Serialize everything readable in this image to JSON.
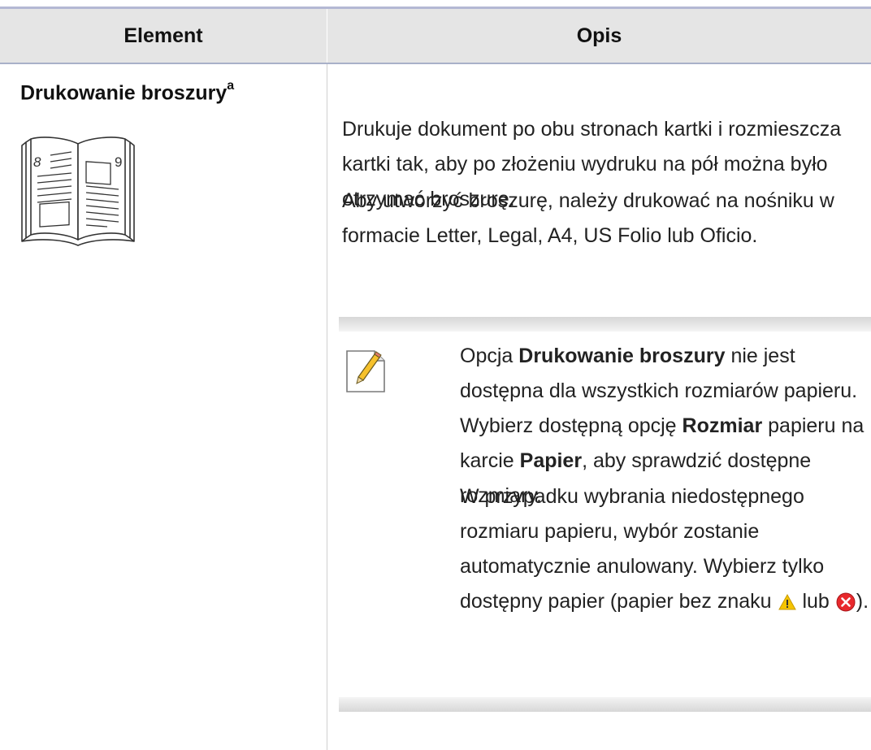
{
  "table": {
    "header": {
      "element": "Element",
      "description": "Opis"
    },
    "row": {
      "element_name": "Drukowanie broszury",
      "element_superscript": "a",
      "description_p1": "Drukuje dokument po obu stronach kartki i rozmieszcza kartki tak, aby po złożeniu wydruku na pół można było otrzymać broszurę.",
      "description_p2": "Aby utworzyć broszurę, należy drukować na nośniku w formacie Letter, Legal, A4, US Folio lub Oficio.",
      "book_icon": {
        "left_page_number": "8",
        "right_page_number": "9"
      }
    }
  },
  "note": {
    "icon": "note-pencil-icon",
    "p1": {
      "t1": "Opcja ",
      "b1": "Drukowanie broszury",
      "t2": " nie jest dostępna dla wszystkich rozmiarów papieru. Wybierz dostępną opcję ",
      "b2": "Rozmiar",
      "t3": " papieru na karcie ",
      "b3": "Papier",
      "t4": ", aby sprawdzić dostępne rozmiary."
    },
    "p2": {
      "t1": "W przypadku wybrania niedostępnego rozmiaru papieru, wybór zostanie automatycznie anulowany. Wybierz tylko dostępny papier (papier bez znaku ",
      "warning_icon": "warning-triangle-icon",
      "t2": " lub ",
      "error_icon": "error-x-icon",
      "t3": ")."
    }
  },
  "colors": {
    "header_background": "#e5e5e5",
    "header_rule": "#b4b8d4",
    "warning": "#f5c400",
    "error": "#e8282c"
  }
}
